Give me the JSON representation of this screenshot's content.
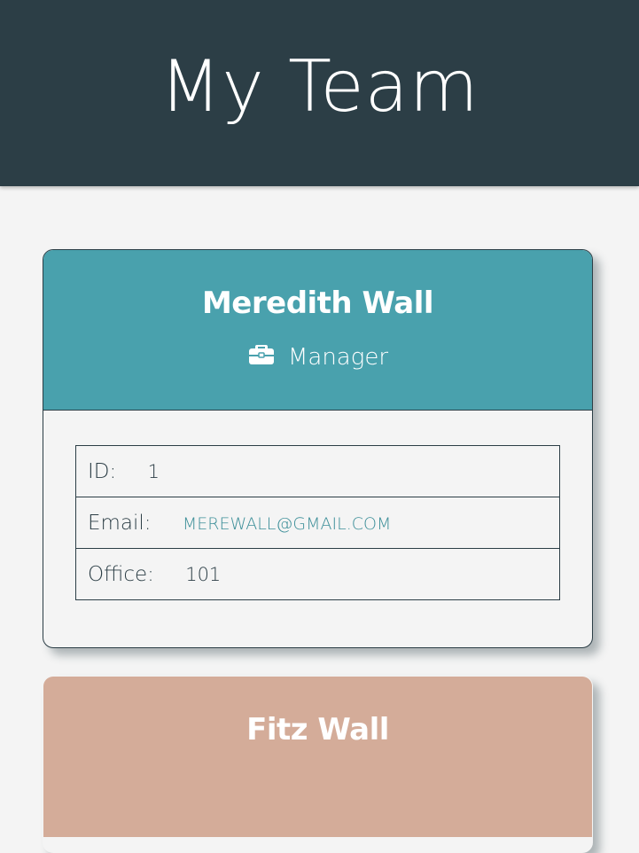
{
  "page": {
    "title": "My Team"
  },
  "team": [
    {
      "name": "Meredith Wall",
      "role": "Manager",
      "role_icon": "briefcase-icon",
      "color": "#49a1ad",
      "fields": {
        "id_label": "ID:",
        "id_value": "1",
        "email_label": "Email:",
        "email_value": "MEREWALL@GMAIL.COM",
        "office_label": "Office:",
        "office_value": "101"
      }
    },
    {
      "name": "Fitz Wall",
      "color": "#d4ac99"
    }
  ]
}
